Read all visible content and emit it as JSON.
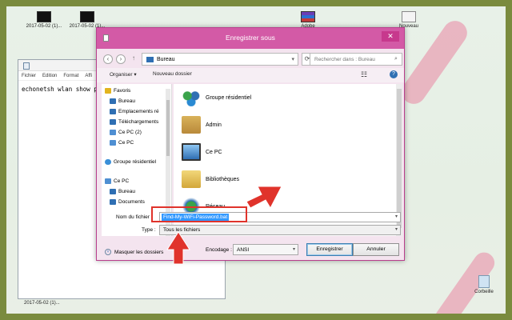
{
  "desktop": {
    "icons": [
      {
        "label": "2017-05-02 (1)...",
        "kind": "black"
      },
      {
        "label": "2017-05-02 (1)...",
        "kind": "black"
      },
      {
        "label": "Adobe",
        "kind": "winrar"
      },
      {
        "label": "Nouveau",
        "kind": "box"
      },
      {
        "label": "Corbeille",
        "kind": "bin"
      }
    ],
    "bottom_caption": "2017-05-02 (1)..."
  },
  "notepad": {
    "menu": [
      "Fichier",
      "Edition",
      "Format",
      "Affi"
    ],
    "text": "echonetsh wlan show p"
  },
  "dialog": {
    "title": "Enregistrer sous",
    "close": "✕",
    "address": "Bureau",
    "search_placeholder": "Rechercher dans : Bureau",
    "toolbar": {
      "organize": "Organiser ▾",
      "new_folder": "Nouveau dossier"
    },
    "nav_pane": [
      {
        "label": "Favoris",
        "icon": "star"
      },
      {
        "label": "Bureau",
        "icon": "folder"
      },
      {
        "label": "Emplacements ré",
        "icon": "folder"
      },
      {
        "label": "Téléchargements",
        "icon": "folder"
      },
      {
        "label": "Ce PC (2)",
        "icon": "pc"
      },
      {
        "label": "Ce PC",
        "icon": "pc"
      },
      {
        "label": "Groupe résidentiel",
        "icon": "group"
      },
      {
        "label": "Ce PC",
        "icon": "pc"
      },
      {
        "label": "Bureau",
        "icon": "folder"
      },
      {
        "label": "Documents",
        "icon": "folder"
      }
    ],
    "content_items": [
      {
        "label": "Groupe résidentiel",
        "icon": "group"
      },
      {
        "label": "Admin",
        "icon": "user"
      },
      {
        "label": "Ce PC",
        "icon": "pc"
      },
      {
        "label": "Bibliothèques",
        "icon": "lib"
      },
      {
        "label": "Réseau",
        "icon": "net"
      }
    ],
    "filename_label": "Nom du fichier :",
    "filename_value": "Find-My-WiFi-Password.bat",
    "type_label": "Type :",
    "type_value": "Tous les fichiers",
    "hide_folders": "Masquer les dossiers",
    "encoding_label": "Encodage :",
    "encoding_value": "ANSI",
    "save_button": "Enregistrer",
    "cancel_button": "Annuler"
  },
  "colors": {
    "title_bar": "#d35aa6",
    "frame": "#7a8b3e",
    "arrow": "#e0332b",
    "selection": "#3399ff"
  }
}
